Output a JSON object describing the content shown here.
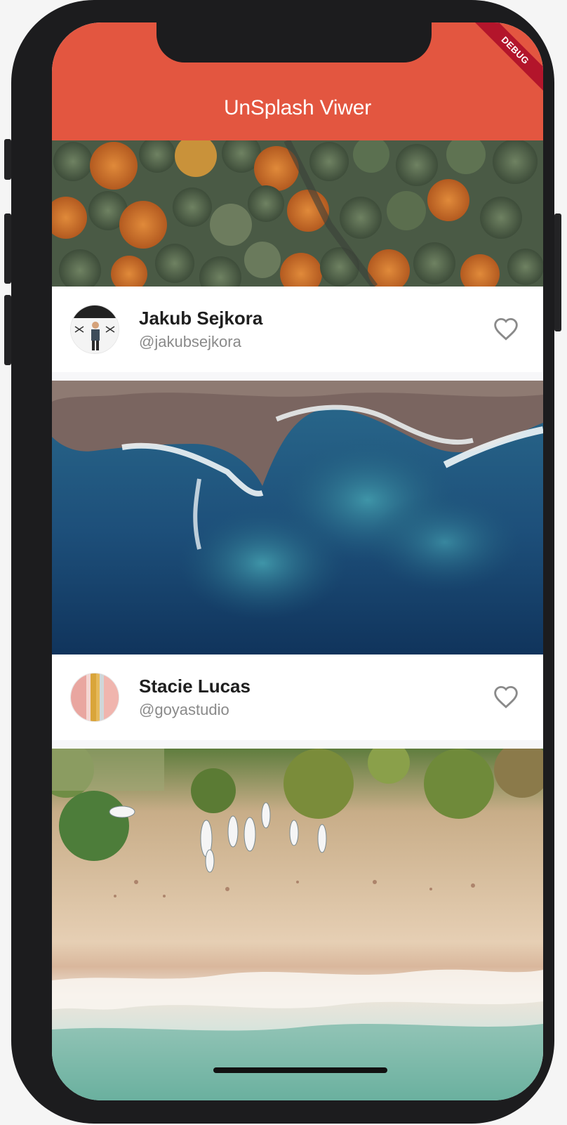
{
  "app": {
    "title": "UnSplash Viwer",
    "debug_label": "DEBUG",
    "appbar_color": "#e35640"
  },
  "posts": [
    {
      "photo": "autumn-forest-aerial",
      "name": "",
      "handle": "",
      "liked": false
    },
    {
      "photo": "coastline-aerial",
      "name": "Jakub Sejkora",
      "handle": "@jakubsejkora",
      "avatar_icon": "person-with-drones-avatar",
      "liked": false
    },
    {
      "photo": "beach-boats-aerial",
      "name": "Stacie Lucas",
      "handle": "@goyastudio",
      "avatar_icon": "striped-pink-yellow-avatar",
      "liked": false
    }
  ],
  "icons": {
    "heart": "heart-outline-icon"
  }
}
